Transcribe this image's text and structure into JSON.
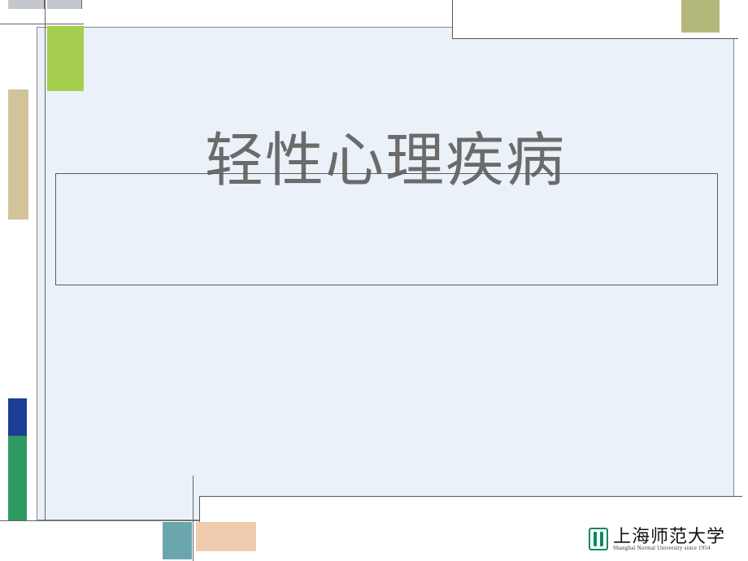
{
  "title": "轻性心理疾病",
  "logo": {
    "name_cn": "上海师范大学",
    "name_en": "Shanghai Normal University since 1954"
  },
  "colors": {
    "panel_bg": "#eaf1f8",
    "accent_green": "#a6ce4e",
    "accent_tan": "#d2c49a",
    "accent_blue": "#1c3f94",
    "accent_emerald": "#2e9a62",
    "accent_teal": "#6aa6ac",
    "accent_peach": "#f0ccae",
    "accent_olive": "#b4b77a",
    "title_text": "#6b6b6b"
  }
}
